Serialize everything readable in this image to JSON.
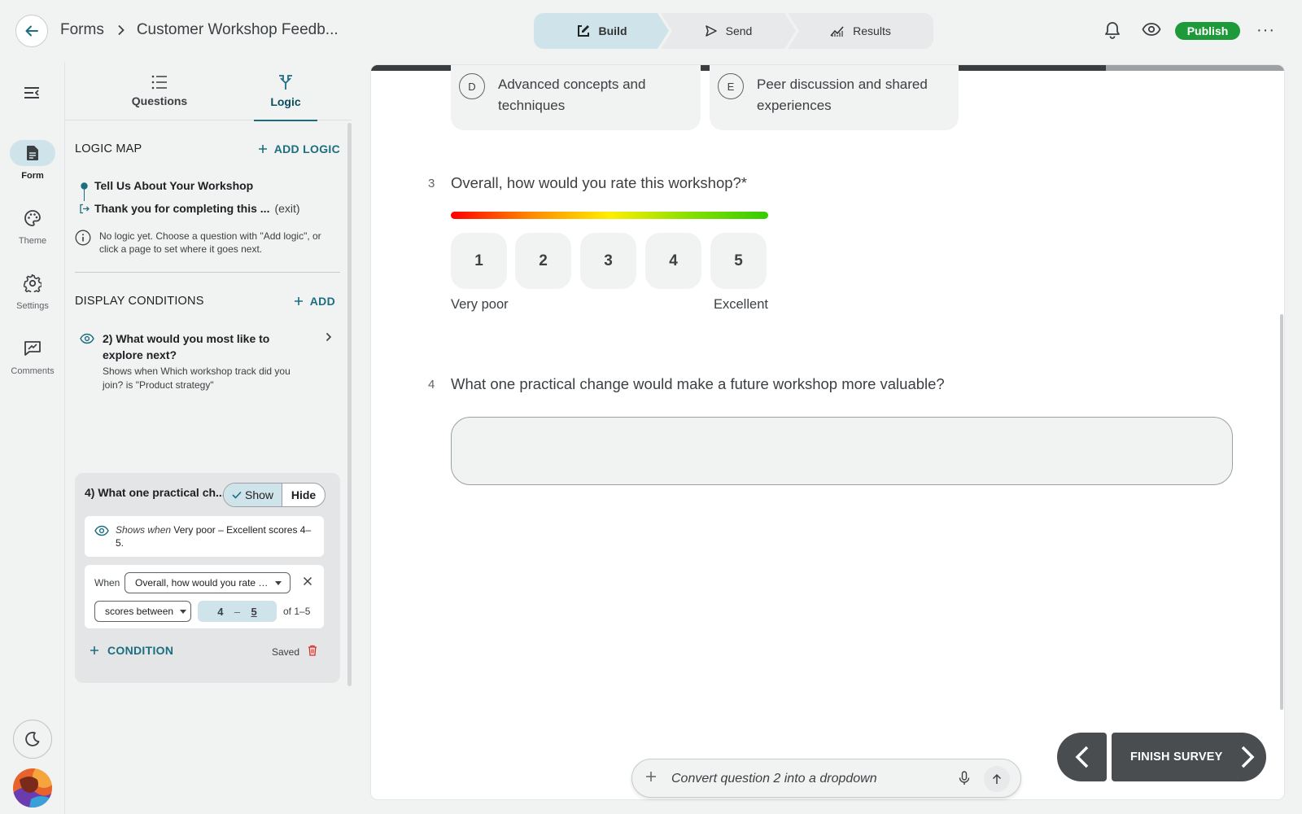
{
  "header": {
    "breadcrumb_root": "Forms",
    "form_title": "Customer Workshop Feedb...",
    "steps": {
      "build": "Build",
      "send": "Send",
      "results": "Results"
    },
    "publish_label": "Publish",
    "more_label": "···"
  },
  "rail": {
    "items": [
      {
        "label": "Form",
        "icon": "document-icon",
        "active": true
      },
      {
        "label": "Theme",
        "icon": "palette-icon"
      },
      {
        "label": "Settings",
        "icon": "gear-icon"
      },
      {
        "label": "Comments",
        "icon": "comment-icon"
      }
    ]
  },
  "panel": {
    "tabs": {
      "questions": "Questions",
      "logic": "Logic"
    },
    "logic_map": {
      "title": "LOGIC MAP",
      "add_label": "ADD LOGIC",
      "start_page": "Tell Us About Your Workshop",
      "end_page": "Thank you for completing this ...",
      "end_suffix": "(exit)",
      "note": "No logic yet. Choose a question with \"Add logic\", or click a page to set where it goes next."
    },
    "display_conditions": {
      "title": "DISPLAY CONDITIONS",
      "add_label": "ADD",
      "q2": {
        "title": "2) What would you most like to explore next?",
        "subtitle": "Shows when Which workshop track did you join? is \"Product strategy\""
      },
      "card": {
        "title": "4) What one practical ch...",
        "show_label": "Show",
        "hide_label": "Hide",
        "shows_when_prefix": "Shows when",
        "shows_when_text": "Very poor – Excellent scores 4–5.",
        "when_label": "When",
        "question_select": "Overall, how would you rate thi...",
        "operator_select": "scores between",
        "range_from": "4",
        "range_dash": "–",
        "range_to": "5",
        "range_of": "of 1–5",
        "add_condition_label": "CONDITION",
        "saved_label": "Saved"
      }
    }
  },
  "canvas": {
    "progress": 0.805,
    "choices": [
      {
        "letter": "D",
        "text": "Advanced concepts and techniques"
      },
      {
        "letter": "E",
        "text": "Peer discussion and shared experiences"
      }
    ],
    "q3": {
      "number": "3",
      "title": "Overall, how would you rate this workshop?*",
      "scale": [
        "1",
        "2",
        "3",
        "4",
        "5"
      ],
      "low_label": "Very poor",
      "high_label": "Excellent"
    },
    "q4": {
      "number": "4",
      "title": "What one practical change would make a future workshop more valuable?"
    },
    "finish_label": "FINISH SURVEY"
  },
  "assistant": {
    "placeholder": "Convert question 2 into a dropdown"
  },
  "colors": {
    "accent": "#1b6e80",
    "accent_light": "#cfe4ea",
    "publish": "#1f9a3a",
    "delete": "#d93025"
  }
}
